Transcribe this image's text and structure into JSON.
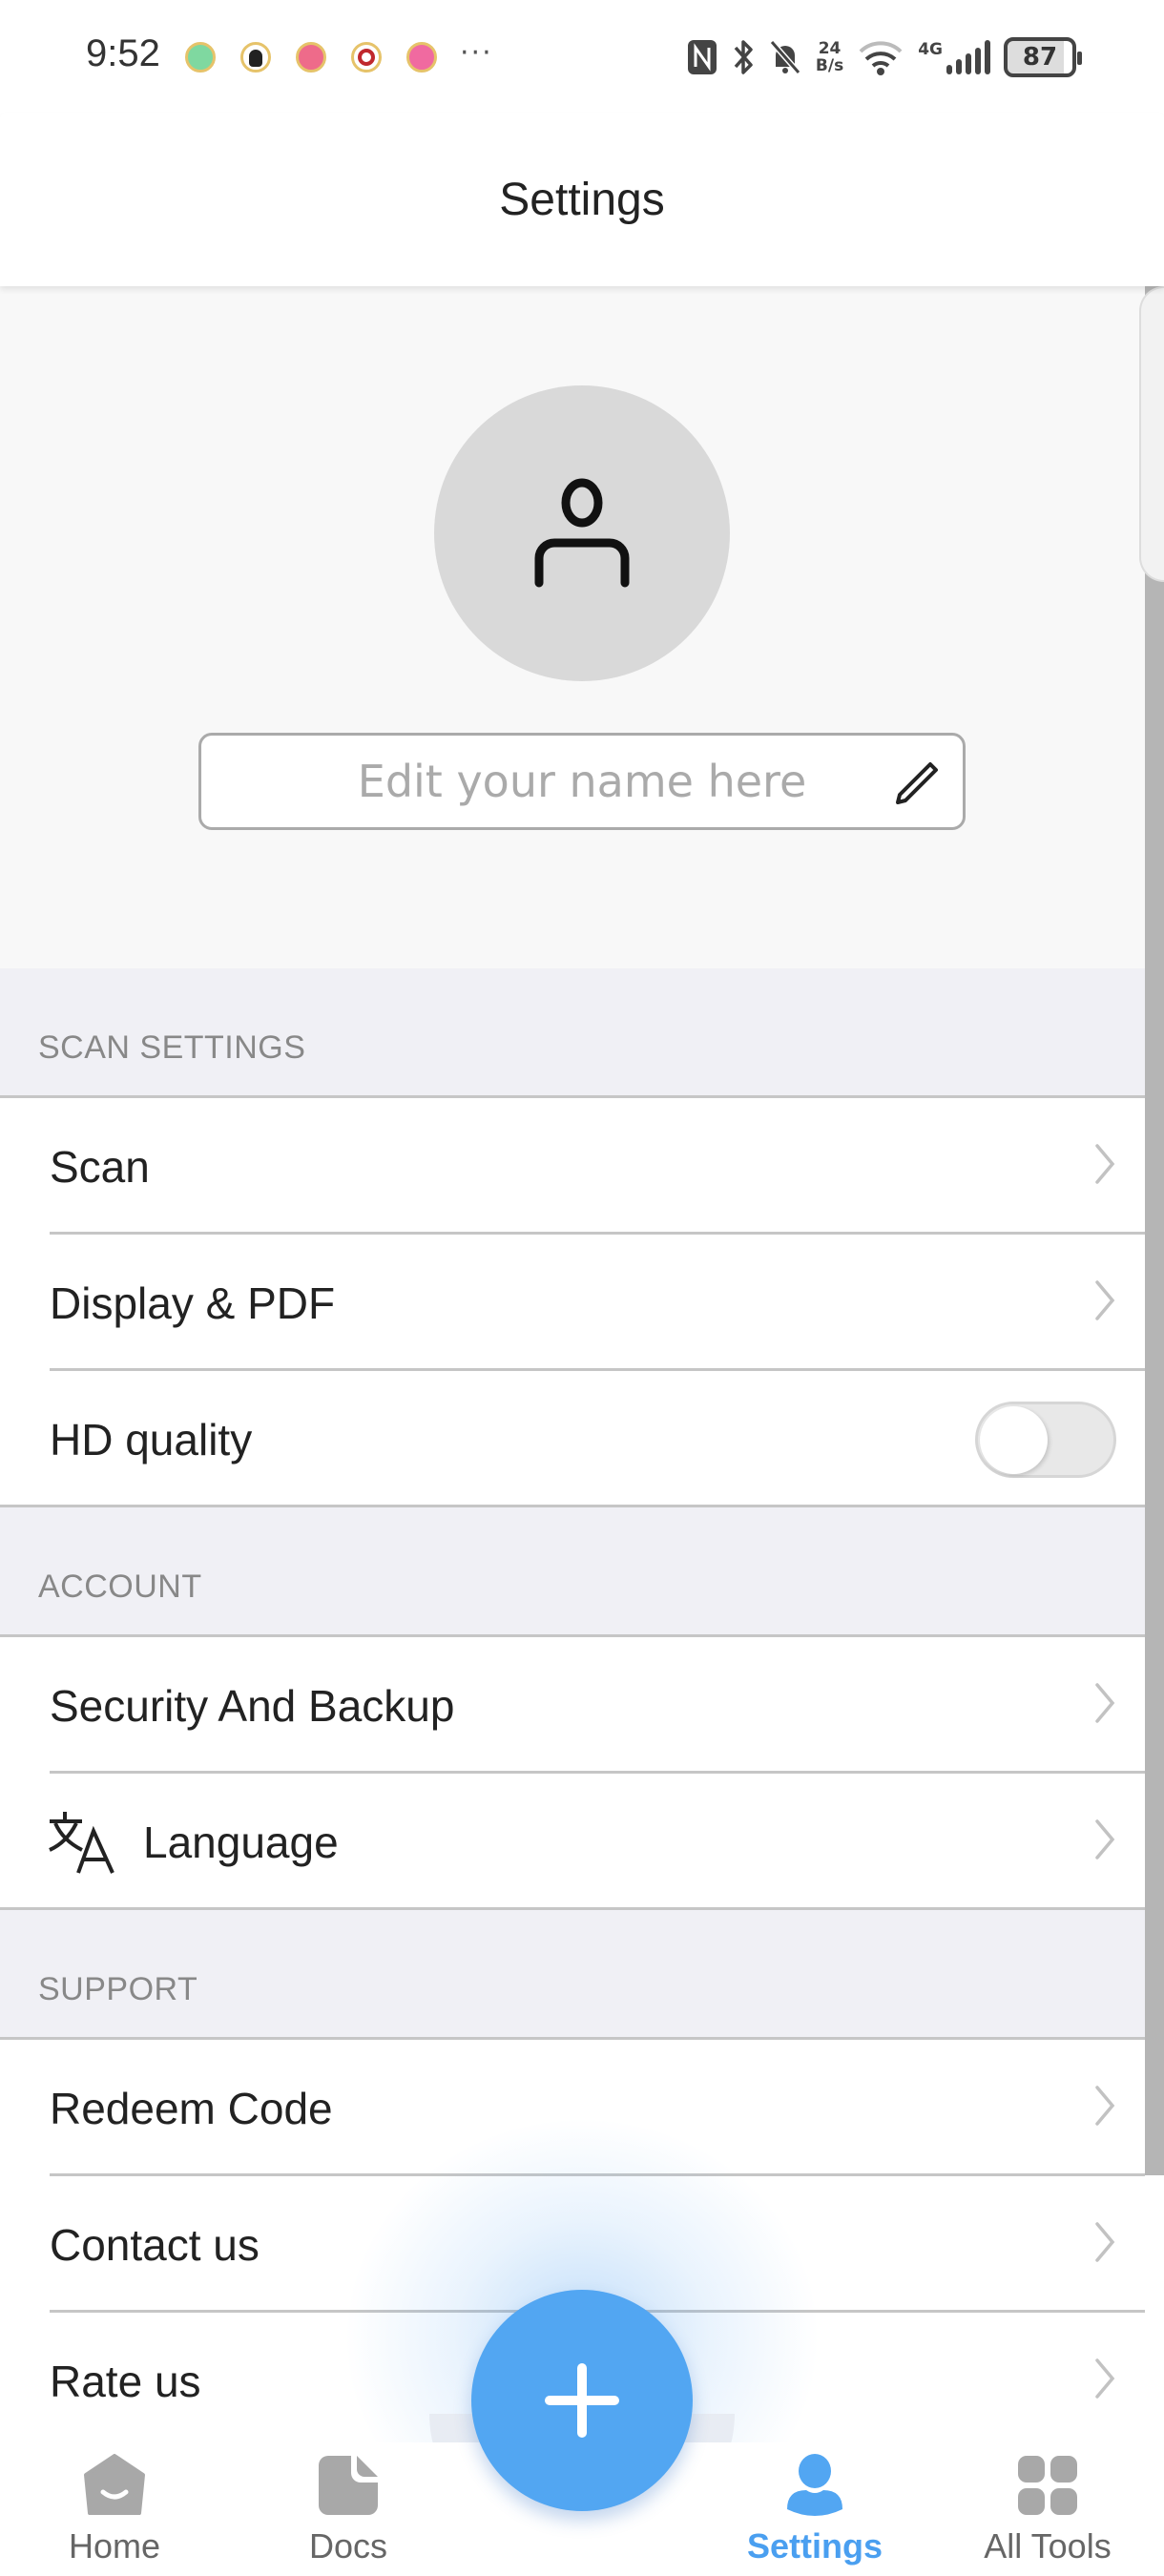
{
  "status_bar": {
    "time": "9:52",
    "notification_icons": [
      "wechat-app-icon",
      "qq-app-icon",
      "bilibili-app-icon",
      "bank-app-icon",
      "shopping-app-icon"
    ],
    "more": "···",
    "net_speed_value": "24",
    "net_speed_unit": "B/s",
    "network_type": "4G",
    "battery": "87"
  },
  "header": {
    "title": "Settings"
  },
  "profile": {
    "name_placeholder": "Edit your name here",
    "name_value": ""
  },
  "sections": [
    {
      "title": "SCAN SETTINGS",
      "items": [
        {
          "label": "Scan",
          "type": "link"
        },
        {
          "label": "Display & PDF",
          "type": "link"
        },
        {
          "label": "HD quality",
          "type": "toggle",
          "enabled": false
        }
      ]
    },
    {
      "title": "ACCOUNT",
      "items": [
        {
          "label": "Security And Backup",
          "type": "link"
        },
        {
          "label": "Language",
          "type": "link",
          "icon": "translate-icon"
        }
      ]
    },
    {
      "title": "SUPPORT",
      "items": [
        {
          "label": "Redeem Code",
          "type": "link"
        },
        {
          "label": "Contact us",
          "type": "link"
        },
        {
          "label": "Rate us",
          "type": "link"
        }
      ]
    }
  ],
  "bottom_nav": {
    "items": [
      {
        "label": "Home",
        "icon": "home-icon",
        "active": false
      },
      {
        "label": "Docs",
        "icon": "document-icon",
        "active": false
      },
      {
        "label": "Settings",
        "icon": "person-icon",
        "active": true
      },
      {
        "label": "All Tools",
        "icon": "grid-icon",
        "active": false
      }
    ],
    "fab_icon": "plus-icon"
  },
  "colors": {
    "accent": "#52a6f2",
    "active_nav": "#4a9ff0",
    "inactive_nav": "#a8a8a8",
    "section_bg": "#f0f0f5",
    "profile_bg": "#f8f8f8"
  }
}
